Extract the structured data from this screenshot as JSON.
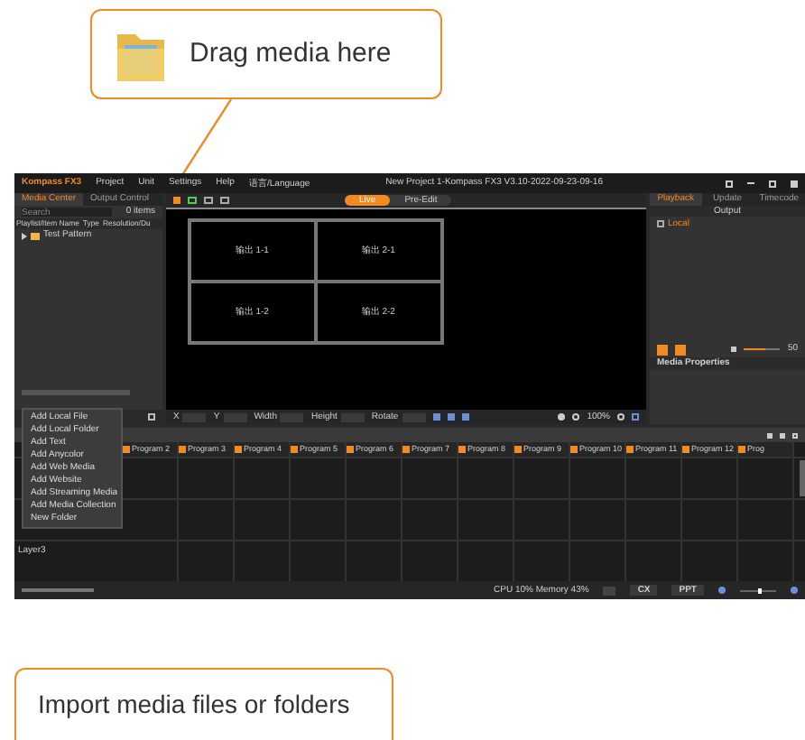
{
  "callouts": [
    {
      "kind": "drag",
      "text": "Drag media here"
    },
    {
      "kind": "import",
      "text": "Import media files or folders"
    }
  ],
  "app": {
    "logo": "Kompass FX3",
    "menu": [
      "Project",
      "Unit",
      "Settings",
      "Help",
      "语言/Language"
    ],
    "title": "New Project 1-Kompass FX3  V3.10-2022-09-23-09-16",
    "left_tabs": [
      {
        "label": "Media Center",
        "selected": true
      },
      {
        "label": "Output Control",
        "selected": false
      }
    ],
    "search": {
      "placeholder": "Search",
      "count": "0 items"
    },
    "media_columns": [
      "Playlist/Item Name",
      "Type",
      "Resolution/Du"
    ],
    "media_tree": [
      {
        "label": "Test Pattern",
        "expanded": false
      }
    ],
    "view_tabs": [
      {
        "label": "Live",
        "selected": true
      },
      {
        "label": "Pre-Edit",
        "selected": false
      }
    ],
    "outputs": [
      "输出 1-1",
      "输出 2-1",
      "输出 1-2",
      "输出 2-2"
    ],
    "transform_fields": [
      "X",
      "Y",
      "Width",
      "Height",
      "Rotate"
    ],
    "zoom": "100%",
    "right_tabs": [
      {
        "label": "Playback",
        "selected": true
      },
      {
        "label": "Update",
        "selected": false
      },
      {
        "label": "Timecode",
        "selected": false
      }
    ],
    "output_header": "Output",
    "output_tree": [
      {
        "label": "Local",
        "checked": false
      }
    ],
    "volume": {
      "level": 0.6,
      "reading": "50"
    },
    "media_properties": "Media Properties",
    "context_menu": [
      "Add Local File",
      "Add Local Folder",
      "Add Text",
      "Add Anycolor",
      "Add Web Media",
      "Add Website",
      "Add Streaming Media",
      "Add Media Collection",
      "New Folder"
    ],
    "programs": [
      "Program 2",
      "Program 3",
      "Program 4",
      "Program 5",
      "Program 6",
      "Program 7",
      "Program 8",
      "Program 9",
      "Program 10",
      "Program 11",
      "Program 12",
      "Prog"
    ],
    "layers": [
      "Layer3"
    ],
    "status": "CPU 10% Memory 43%",
    "status_buttons": [
      "CX",
      "PPT"
    ],
    "timeline_zoom": {
      "level": 0.5
    }
  }
}
